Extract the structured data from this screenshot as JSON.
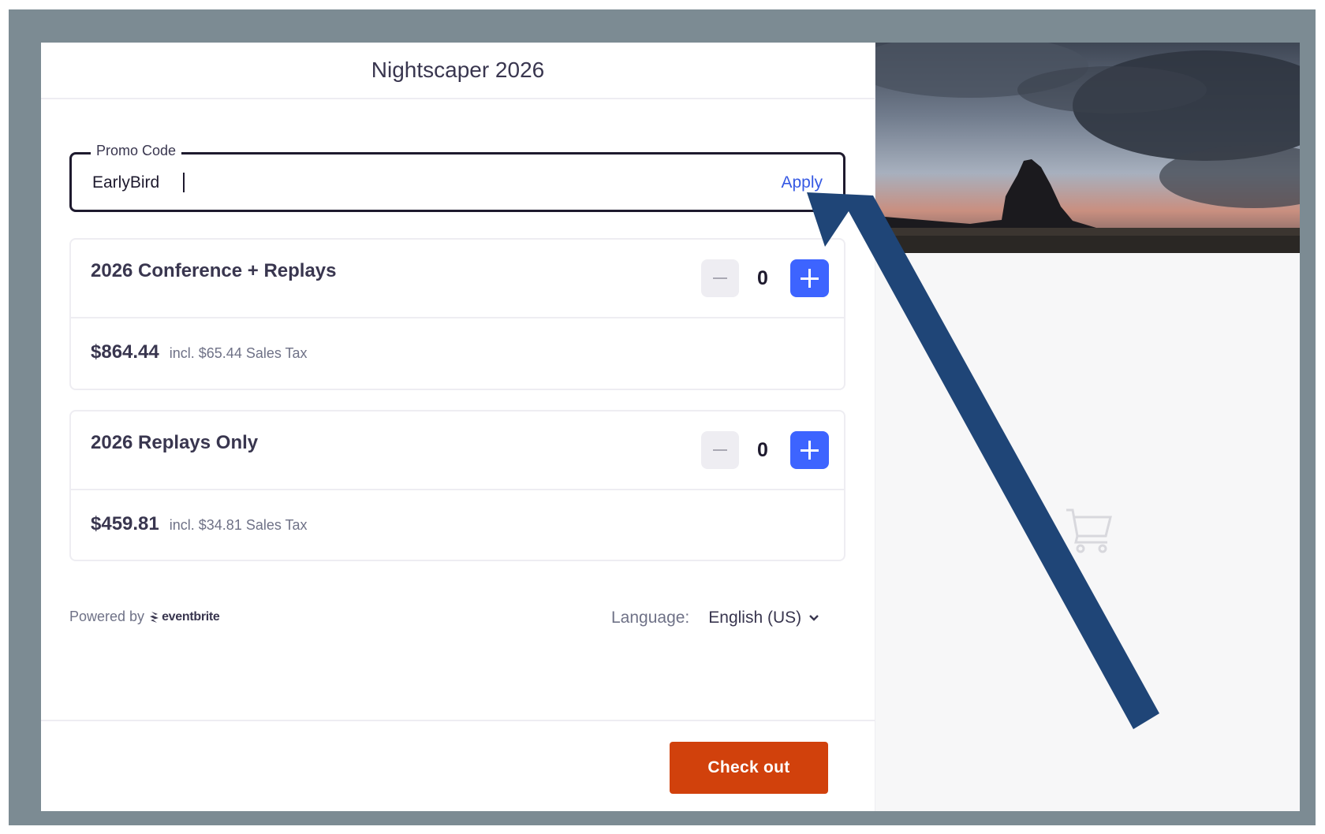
{
  "event": {
    "title": "Nightscaper 2026"
  },
  "promo": {
    "label": "Promo Code",
    "value": "EarlyBird",
    "apply_label": "Apply"
  },
  "tickets": [
    {
      "name": "2026 Conference + Replays",
      "quantity": "0",
      "price": "$864.44",
      "tax": "incl. $65.44 Sales Tax"
    },
    {
      "name": "2026 Replays Only",
      "quantity": "0",
      "price": "$459.81",
      "tax": "incl. $34.81 Sales Tax"
    }
  ],
  "footer": {
    "powered_by": "Powered by",
    "brand": "eventbrite",
    "language_label": "Language:",
    "language_value": "English (US)"
  },
  "checkout": {
    "label": "Check out"
  },
  "colors": {
    "accent": "#3d64ff",
    "checkout": "#d1410c",
    "annotation_arrow": "#1f4577",
    "frame": "#7c8b93"
  },
  "icons": [
    "minus-icon",
    "plus-icon",
    "chevron-down-icon",
    "cart-icon",
    "eventbrite-logo-icon"
  ]
}
